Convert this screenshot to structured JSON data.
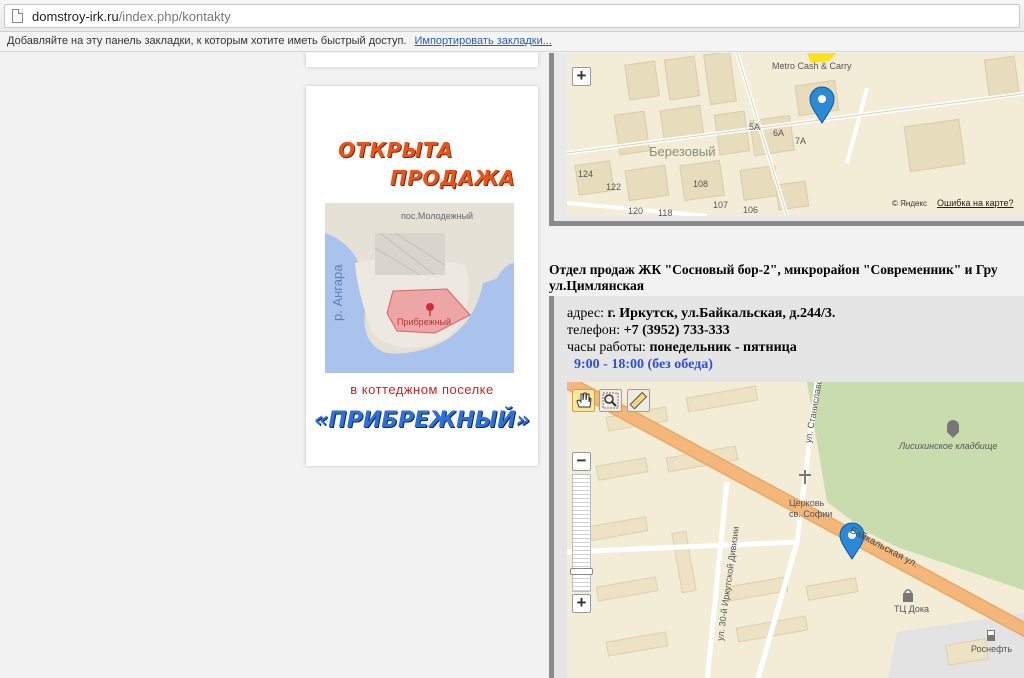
{
  "browser": {
    "url_domain": "domstroy-irk.ru",
    "url_path": "/index.php/kontakty",
    "bookmarks_prompt": "Добавляйте на эту панель закладки, к которым хотите иметь быстрый доступ.",
    "import_link": "Импортировать закладки..."
  },
  "promo": {
    "line1": "ОТКРЫТА",
    "line2": "ПРОДАЖА",
    "map_labels": {
      "village": "пос.Молодежный",
      "river": "р. Ангара",
      "site": "Прибрежный"
    },
    "subtitle": "в коттеджном поселке",
    "name": "«ПРИБРЕЖНЫЙ»",
    "colors": {
      "headline": "#e8541c",
      "subtitle": "#d0201f",
      "name": "#2f6fd8"
    }
  },
  "map1": {
    "labels": {
      "store": "Metro Cash & Carry",
      "district": "Березовый",
      "house_5a": "5А",
      "house_6a": "6А",
      "house_7a": "7А",
      "house_124": "124",
      "house_122": "122",
      "house_120": "120",
      "house_118": "118",
      "house_108": "108",
      "house_107": "107",
      "house_106": "106"
    },
    "copyright": "© Яндекс",
    "error_link": "Ошибка на карте?",
    "zoom_in_label": "+"
  },
  "sales_office": {
    "title_line1": "Отдел продаж ЖК \"Сосновый бор-2\", микрорайон \"Современник\" и Гру",
    "title_line2": "ул.Цимлянская",
    "address_label": "адрес:",
    "address_value": "г. Иркутск, ул.Байкальская, д.244/3.",
    "phone_label": "телефон:",
    "phone_value": "+7 (3952) 733-333",
    "hours_label": "часы работы:",
    "hours_days": "понедельник - пятница",
    "hours_time": "9:00 - 18:00 (без обеда)"
  },
  "map2": {
    "labels": {
      "street_stanislavsky": "ул. Станиславско",
      "cemetery": "Лисихинское кладбище",
      "church_line1": "Церковь",
      "church_line2": "св. Софии",
      "baikalskaya": "Байкальская ул.",
      "division_street": "ул. 30-й Иркутской Дивизии",
      "mall": "ТЦ Дока",
      "fuel": "Роснефть"
    },
    "zoom_out_label": "−",
    "zoom_in_label": "+",
    "zoom_level": 0.15,
    "colors": {
      "road": "#f4b77b",
      "park": "#c8dcae",
      "land": "#f3ecd7",
      "marker": "#2a8ad8"
    }
  }
}
